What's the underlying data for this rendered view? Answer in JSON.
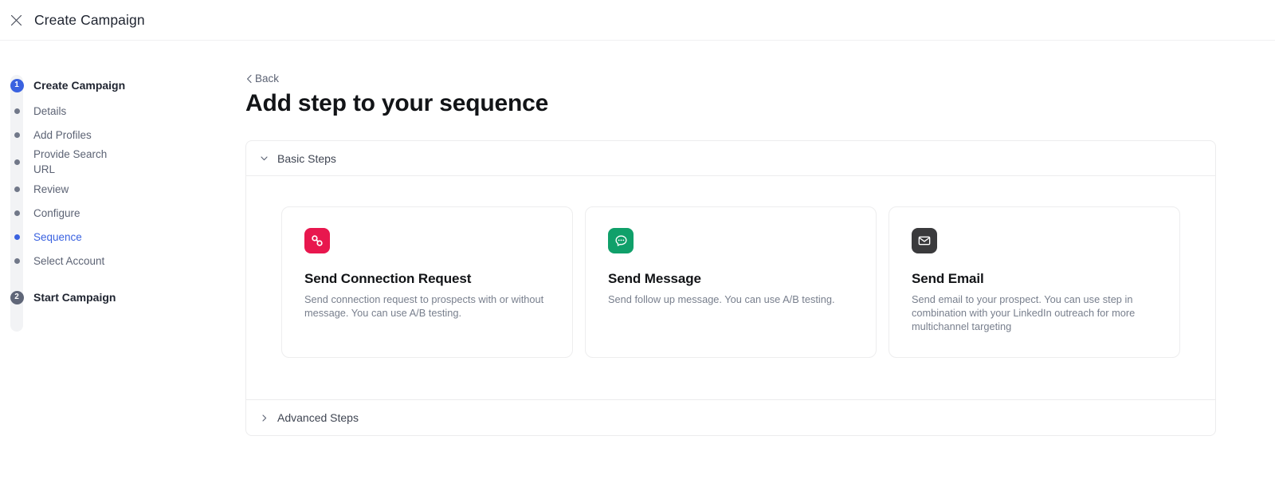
{
  "header": {
    "title": "Create Campaign",
    "close_icon": "close-icon"
  },
  "sidebar": {
    "steps": [
      {
        "number": "1",
        "label": "Create Campaign",
        "type": "major",
        "state": "active"
      },
      {
        "label": "Details",
        "type": "sub",
        "state": "done"
      },
      {
        "label": "Add Profiles",
        "type": "sub",
        "state": "done"
      },
      {
        "label": "Provide Search URL",
        "type": "sub",
        "state": "done"
      },
      {
        "label": "Review",
        "type": "sub",
        "state": "done"
      },
      {
        "label": "Configure",
        "type": "sub",
        "state": "done"
      },
      {
        "label": "Sequence",
        "type": "sub",
        "state": "current"
      },
      {
        "label": "Select Account",
        "type": "sub",
        "state": "done"
      },
      {
        "number": "2",
        "label": "Start Campaign",
        "type": "major",
        "state": "pending"
      }
    ]
  },
  "main": {
    "back_label": "Back",
    "back_icon": "chevron-left-icon",
    "page_title": "Add step to your sequence",
    "sections": [
      {
        "title": "Basic Steps",
        "icon": "chevron-down-icon",
        "expanded": true
      },
      {
        "title": "Advanced Steps",
        "icon": "chevron-right-icon",
        "expanded": false
      }
    ],
    "cards": [
      {
        "title": "Send Connection Request",
        "description": "Send connection request to prospects with or without message. You can use A/B testing.",
        "icon": "link-chain-icon",
        "icon_bg": "#E8174E"
      },
      {
        "title": "Send Message",
        "description": "Send follow up message. You can use A/B testing.",
        "icon": "chat-bubble-icon",
        "icon_bg": "#10A06A"
      },
      {
        "title": "Send Email",
        "description": "Send email to your prospect. You can use step in combination with your LinkedIn outreach for more multichannel targeting",
        "icon": "envelope-icon",
        "icon_bg": "#3A3A3C"
      }
    ]
  },
  "colors": {
    "accent_blue": "#3A62E0",
    "pending_gray": "#5F6678",
    "text_dark": "#121417",
    "text_muted": "#787F8D",
    "border": "#ECECED"
  }
}
